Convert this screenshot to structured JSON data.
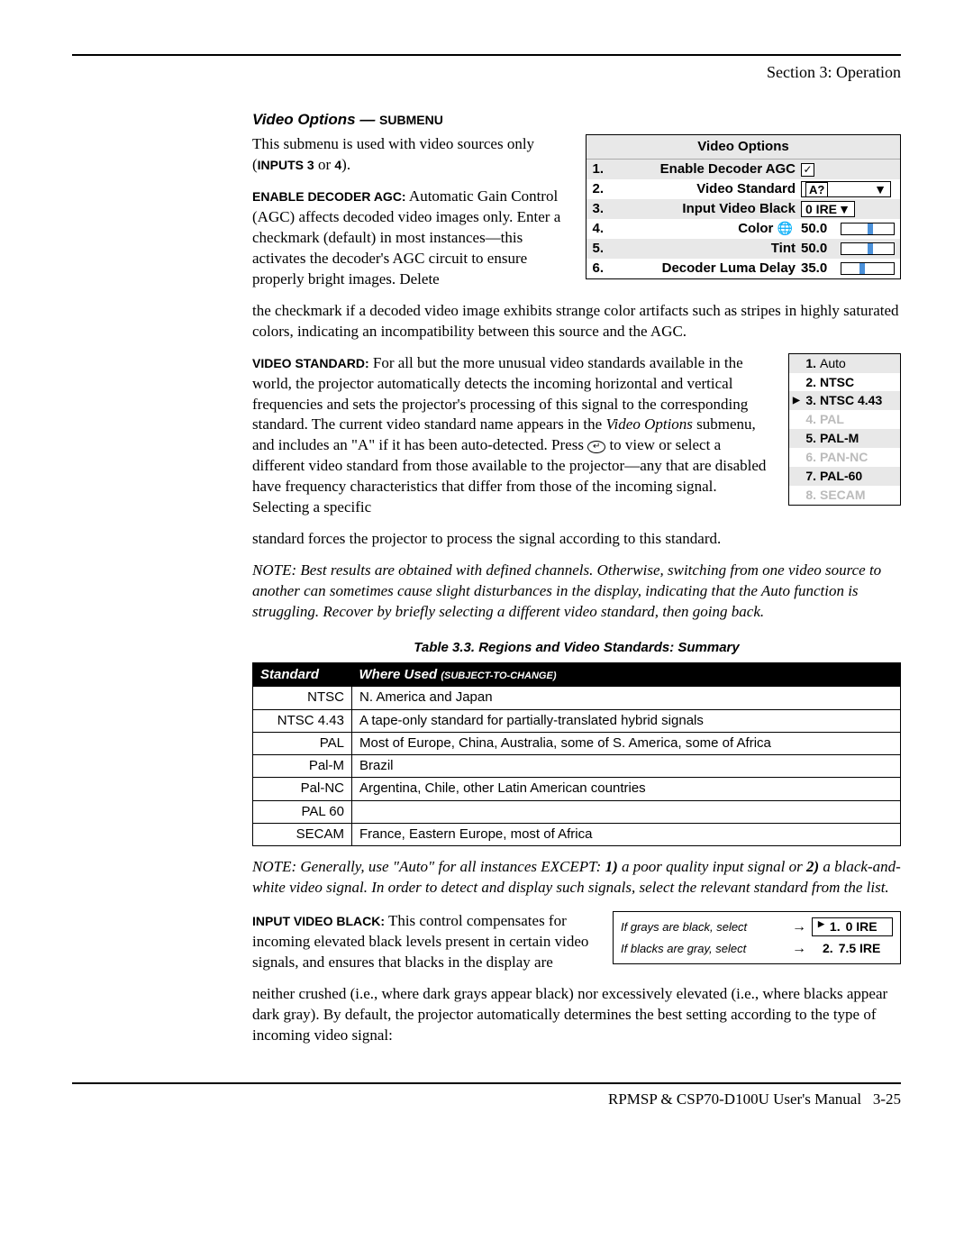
{
  "header": {
    "section": "Section 3: Operation"
  },
  "footer": {
    "manual": "RPMSP & CSP70-D100U User's Manual",
    "pagenum": "3-25"
  },
  "title": {
    "main": "Video Options",
    "dash": " — ",
    "sub": "SUBMENU"
  },
  "intro": {
    "line1a": "This submenu is used with video sources only (",
    "inputs": "INPUTS 3",
    "or": " or ",
    "four": "4",
    "close": ")."
  },
  "agc": {
    "label": "ENABLE DECODER AGC:",
    "text1": " Automatic Gain Control (AGC) affects decoded video images only. Enter a checkmark (default) in most instances—this activates the decoder's AGC circuit to ensure properly bright images. Delete",
    "text2": "the checkmark if a decoded video image exhibits strange color artifacts such as stripes in highly saturated colors, indicating an incompatibility between this source and the AGC."
  },
  "menu": {
    "title": "Video Options",
    "rows": {
      "r1": {
        "n": "1.",
        "label": "Enable Decoder AGC"
      },
      "r2": {
        "n": "2.",
        "label": "Video Standard",
        "val": "A?"
      },
      "r3": {
        "n": "3.",
        "label": "Input Video Black",
        "val": "0 IRE"
      },
      "r4": {
        "n": "4.",
        "label": "Color",
        "val": "50.0"
      },
      "r5": {
        "n": "5.",
        "label": "Tint",
        "val": "50.0"
      },
      "r6": {
        "n": "6.",
        "label": "Decoder Luma Delay",
        "val": "35.0"
      }
    }
  },
  "vstd": {
    "label": "VIDEO STANDARD:",
    "p1a": " For all but the more unusual video standards available in the world, the projector automatically detects the incoming horizontal and vertical frequencies and sets the projector's processing of this signal to the corresponding standard. The current video standard name appears in the ",
    "p1i": "Video Options",
    "p1b": " submenu, and includes an \"A\" if it has been auto-detected. Press ",
    "p1c": " to view or select a different video standard from those available to the projector—any that are disabled have frequency characteristics that differ from those of the incoming signal. Selecting a specific",
    "p2": "standard forces the projector to process the signal according to this standard.",
    "note": "NOTE: Best results are obtained with defined channels. Otherwise, switching from one video source to another can sometimes cause slight disturbances in the display, indicating that the Auto function is struggling. Recover by briefly selecting a different video standard, then going back."
  },
  "stdlist": {
    "r1": {
      "n": "1.",
      "label": "Auto"
    },
    "r2": {
      "n": "2.",
      "label": "NTSC"
    },
    "r3": {
      "n": "3.",
      "label": "NTSC 4.43"
    },
    "r4": {
      "n": "4.",
      "label": "PAL"
    },
    "r5": {
      "n": "5.",
      "label": "PAL-M"
    },
    "r6": {
      "n": "6.",
      "label": "PAN-NC"
    },
    "r7": {
      "n": "7.",
      "label": "PAL-60"
    },
    "r8": {
      "n": "8.",
      "label": "SECAM"
    }
  },
  "table": {
    "caption": "Table 3.3. Regions and Video Standards: Summary",
    "h1": "Standard",
    "h2a": "Where Used ",
    "h2b": "(SUBJECT-TO-CHANGE)",
    "rows": [
      {
        "std": "NTSC",
        "where": "N. America and Japan"
      },
      {
        "std": "NTSC 4.43",
        "where": "A tape-only standard for partially-translated hybrid signals"
      },
      {
        "std": "PAL",
        "where": "Most of Europe, China, Australia, some of S. America, some of Africa"
      },
      {
        "std": "Pal-M",
        "where": "Brazil"
      },
      {
        "std": "Pal-NC",
        "where": "Argentina, Chile, other Latin American countries"
      },
      {
        "std": "PAL 60",
        "where": ""
      },
      {
        "std": "SECAM",
        "where": "France, Eastern Europe, most of Africa"
      }
    ]
  },
  "note2a": "NOTE: Generally, use \"Auto\" for all instances EXCEPT: ",
  "note2b": "1)",
  "note2c": " a poor quality input signal or ",
  "note2d": "2)",
  "note2e": " a black-and-white video signal. In order to detect and display such signals, select the relevant standard from the list.",
  "ivb": {
    "label": "INPUT VIDEO BLACK:",
    "text1": " This control compensates for incoming elevated black levels present in certain video signals, and ensures that blacks in the display are",
    "text2": "neither crushed (i.e., where dark grays appear black) nor excessively elevated (i.e., where blacks appear dark gray). By default, the projector automatically determines the best setting according to the type of incoming video signal:"
  },
  "irebox": {
    "l1": "If grays are black, select",
    "l2": "If blacks are gray, select",
    "v1n": "1.",
    "v1": "0  IRE",
    "v2n": "2.",
    "v2": "7.5  IRE"
  }
}
